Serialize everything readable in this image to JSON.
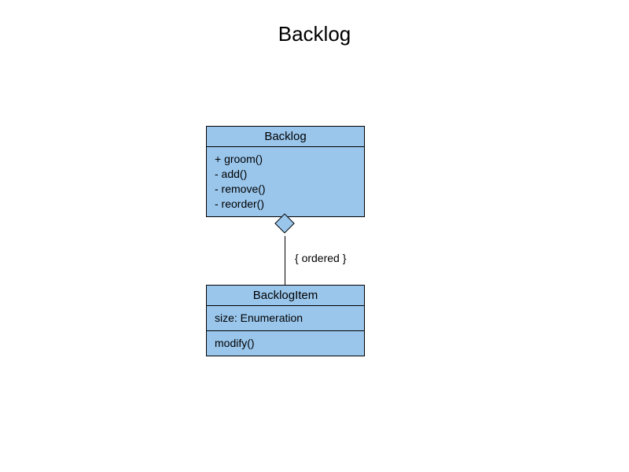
{
  "title": "Backlog",
  "classes": {
    "backlog": {
      "name": "Backlog",
      "operations": [
        "+ groom()",
        "- add()",
        "- remove()",
        "- reorder()"
      ]
    },
    "backlogItem": {
      "name": "BacklogItem",
      "attributes": [
        "size: Enumeration"
      ],
      "operations": [
        "modify()"
      ]
    }
  },
  "association": {
    "constraint": "{ ordered }"
  }
}
